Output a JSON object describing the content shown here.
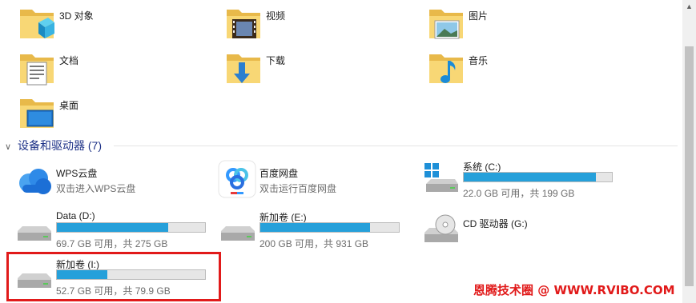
{
  "folders": [
    {
      "label": "3D 对象",
      "icon": "3d-objects-folder-icon"
    },
    {
      "label": "视频",
      "icon": "videos-folder-icon"
    },
    {
      "label": "图片",
      "icon": "pictures-folder-icon"
    },
    {
      "label": "文档",
      "icon": "documents-folder-icon"
    },
    {
      "label": "下载",
      "icon": "downloads-folder-icon"
    },
    {
      "label": "音乐",
      "icon": "music-folder-icon"
    },
    {
      "label": "桌面",
      "icon": "desktop-folder-icon"
    }
  ],
  "section": {
    "title": "设备和驱动器 (7)"
  },
  "drives": [
    {
      "name": "WPS云盘",
      "sub": "双击进入WPS云盘",
      "icon": "wps-cloud-icon"
    },
    {
      "name": "百度网盘",
      "sub": "双击运行百度网盘",
      "icon": "baidu-netdisk-icon"
    },
    {
      "name": "系统 (C:)",
      "usage": "22.0 GB 可用，共 199 GB",
      "used_fraction": 0.89,
      "icon": "windows-drive-icon"
    },
    {
      "name": "Data (D:)",
      "usage": "69.7 GB 可用，共 275 GB",
      "used_fraction": 0.75,
      "icon": "hard-drive-icon"
    },
    {
      "name": "新加卷 (E:)",
      "usage": "200 GB 可用，共 931 GB",
      "used_fraction": 0.79,
      "icon": "hard-drive-icon"
    },
    {
      "name": "CD 驱动器 (G:)",
      "icon": "cd-drive-icon"
    },
    {
      "name": "新加卷 (I:)",
      "usage": "52.7 GB 可用，共 79.9 GB",
      "used_fraction": 0.34,
      "icon": "hard-drive-icon"
    }
  ],
  "colors": {
    "accent": "#26a0da",
    "highlight": "#e11a1a",
    "section": "#1e3287"
  },
  "watermark": "恩腾技术圈 @ WWW.RVIBO.COM"
}
